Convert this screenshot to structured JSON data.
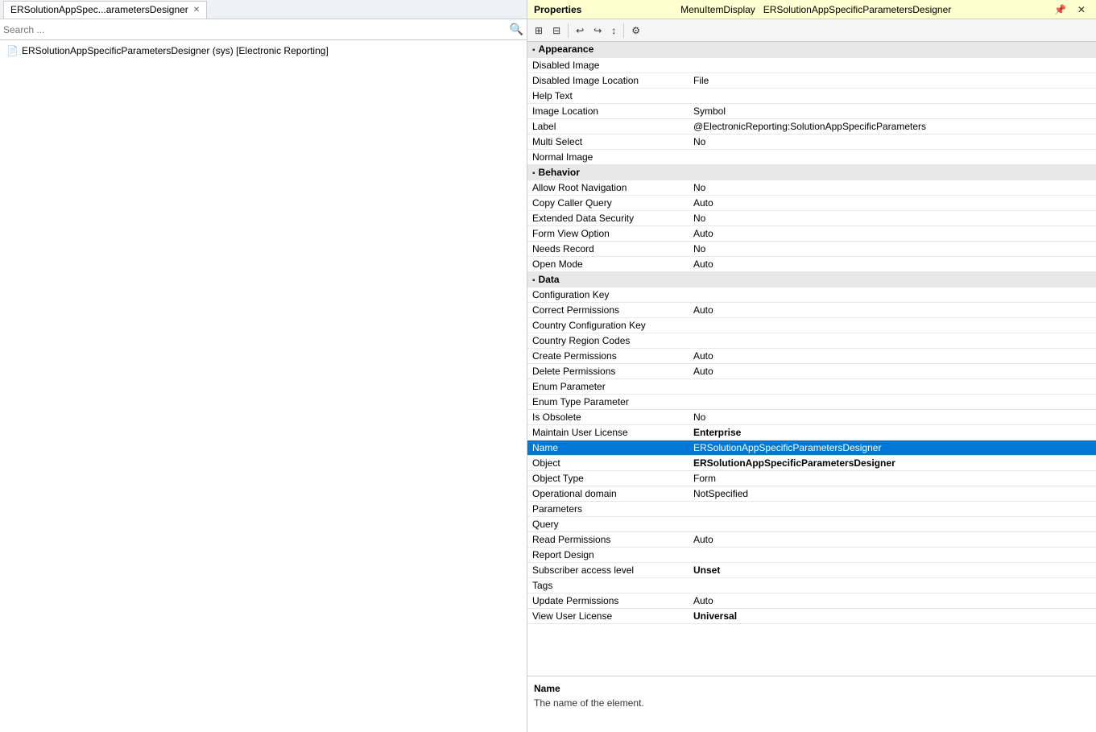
{
  "left": {
    "tab_label": "ERSolutionAppSpec...arametersDesigner",
    "search_placeholder": "Search ...",
    "tree_item": "ERSolutionAppSpecificParametersDesigner (sys) [Electronic Reporting]"
  },
  "right": {
    "header": {
      "type_label": "MenuItemDisplay",
      "name_value": "ERSolutionAppSpecificParametersDesigner",
      "title": "Properties"
    },
    "toolbar_buttons": [
      "categorized-icon",
      "alphabetical-icon",
      "separator",
      "back-icon",
      "forward-icon",
      "sort-icon",
      "separator2",
      "settings-icon"
    ],
    "sections": [
      {
        "name": "Appearance",
        "properties": [
          {
            "name": "Disabled Image",
            "value": ""
          },
          {
            "name": "Disabled Image Location",
            "value": "File"
          },
          {
            "name": "Help Text",
            "value": ""
          },
          {
            "name": "Image Location",
            "value": "Symbol"
          },
          {
            "name": "Label",
            "value": "@ElectronicReporting:SolutionAppSpecificParameters",
            "bold": false
          },
          {
            "name": "Multi Select",
            "value": "No"
          },
          {
            "name": "Normal Image",
            "value": ""
          }
        ]
      },
      {
        "name": "Behavior",
        "properties": [
          {
            "name": "Allow Root Navigation",
            "value": "No"
          },
          {
            "name": "Copy Caller Query",
            "value": "Auto"
          },
          {
            "name": "Extended Data Security",
            "value": "No"
          },
          {
            "name": "Form View Option",
            "value": "Auto"
          },
          {
            "name": "Needs Record",
            "value": "No"
          },
          {
            "name": "Open Mode",
            "value": "Auto"
          }
        ]
      },
      {
        "name": "Data",
        "properties": [
          {
            "name": "Configuration Key",
            "value": ""
          },
          {
            "name": "Correct Permissions",
            "value": "Auto"
          },
          {
            "name": "Country Configuration Key",
            "value": ""
          },
          {
            "name": "Country Region Codes",
            "value": ""
          },
          {
            "name": "Create Permissions",
            "value": "Auto"
          },
          {
            "name": "Delete Permissions",
            "value": "Auto"
          },
          {
            "name": "Enum Parameter",
            "value": ""
          },
          {
            "name": "Enum Type Parameter",
            "value": ""
          },
          {
            "name": "Is Obsolete",
            "value": "No"
          },
          {
            "name": "Maintain User License",
            "value": "Enterprise",
            "bold": true
          },
          {
            "name": "Name",
            "value": "ERSolutionAppSpecificParametersDesigner",
            "selected": true
          },
          {
            "name": "Object",
            "value": "ERSolutionAppSpecificParametersDesigner",
            "bold": true
          },
          {
            "name": "Object Type",
            "value": "Form"
          },
          {
            "name": "Operational domain",
            "value": "NotSpecified"
          },
          {
            "name": "Parameters",
            "value": ""
          },
          {
            "name": "Query",
            "value": ""
          },
          {
            "name": "Read Permissions",
            "value": "Auto"
          },
          {
            "name": "Report Design",
            "value": ""
          },
          {
            "name": "Subscriber access level",
            "value": "Unset",
            "bold": true
          },
          {
            "name": "Tags",
            "value": ""
          },
          {
            "name": "Update Permissions",
            "value": "Auto"
          },
          {
            "name": "View User License",
            "value": "Universal",
            "bold": true
          }
        ]
      }
    ],
    "footer": {
      "prop_name": "Name",
      "prop_desc": "The name of the element."
    }
  }
}
